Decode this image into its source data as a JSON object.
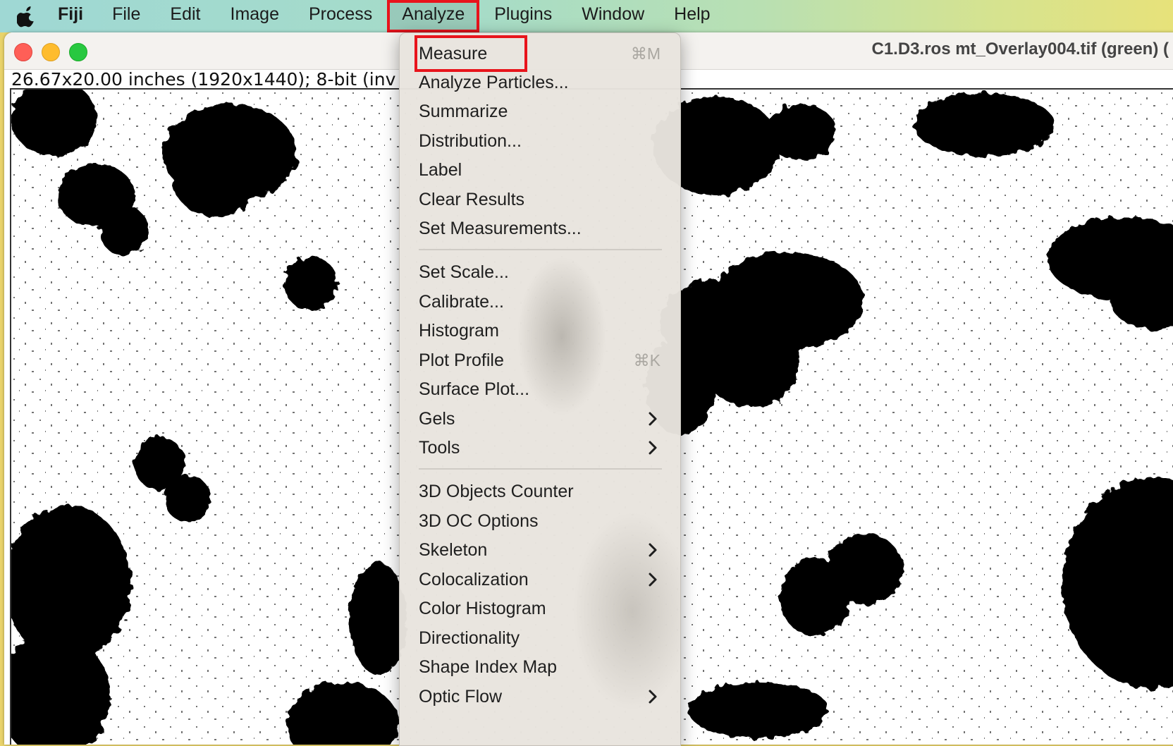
{
  "menubar": {
    "app_name": "Fiji",
    "items": [
      "File",
      "Edit",
      "Image",
      "Process",
      "Analyze",
      "Plugins",
      "Window",
      "Help"
    ],
    "active_item": "Analyze"
  },
  "window": {
    "title": "C1.D3.ros mt_Overlay004.tif (green) (",
    "info": "26.67x20.00 inches (1920x1440); 8-bit (inv"
  },
  "analyze_menu": {
    "group1": [
      {
        "label": "Measure",
        "shortcut": "⌘M"
      },
      {
        "label": "Analyze Particles..."
      },
      {
        "label": "Summarize"
      },
      {
        "label": "Distribution..."
      },
      {
        "label": "Label"
      },
      {
        "label": "Clear Results"
      },
      {
        "label": "Set Measurements..."
      }
    ],
    "group2": [
      {
        "label": "Set Scale..."
      },
      {
        "label": "Calibrate..."
      },
      {
        "label": "Histogram"
      },
      {
        "label": "Plot Profile",
        "shortcut": "⌘K"
      },
      {
        "label": "Surface Plot..."
      },
      {
        "label": "Gels",
        "submenu": true
      },
      {
        "label": "Tools",
        "submenu": true
      }
    ],
    "group3": [
      {
        "label": "3D Objects Counter"
      },
      {
        "label": "3D OC Options"
      },
      {
        "label": "Skeleton",
        "submenu": true
      },
      {
        "label": "Colocalization",
        "submenu": true
      },
      {
        "label": "Color Histogram"
      },
      {
        "label": "Directionality"
      },
      {
        "label": "Shape Index Map"
      },
      {
        "label": "Optic Flow",
        "submenu": true
      }
    ]
  },
  "colors": {
    "highlight": "#e8141c",
    "menu_bg": "#e8e4de"
  }
}
